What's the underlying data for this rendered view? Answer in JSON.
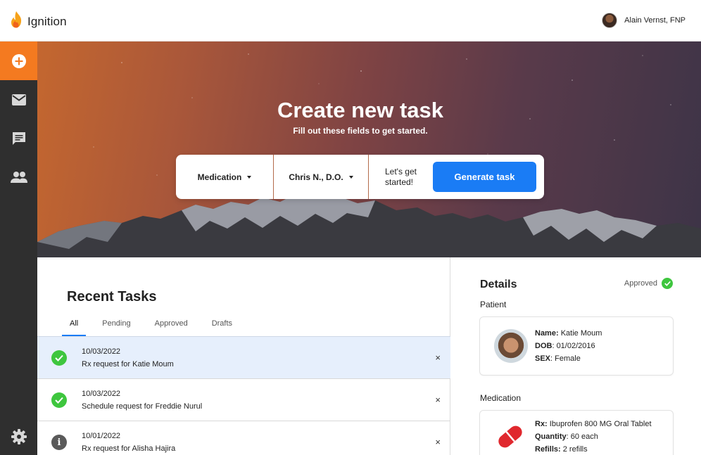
{
  "app": {
    "name": "Ignition",
    "user_name": "Alain Vernst, FNP"
  },
  "sidebar": {
    "items": [
      {
        "name": "add-icon",
        "active": true
      },
      {
        "name": "mail-icon",
        "active": false
      },
      {
        "name": "chat-icon",
        "active": false
      },
      {
        "name": "people-icon",
        "active": false
      }
    ],
    "bottom": {
      "name": "gear-icon"
    }
  },
  "hero": {
    "title": "Create new task",
    "subtitle": "Fill out these fields to get started.",
    "task_type": "Medication",
    "provider": "Chris N., D.O.",
    "hint": "Let's get started!",
    "generate_label": "Generate task"
  },
  "recent": {
    "title": "Recent Tasks",
    "tabs": [
      {
        "label": "All",
        "active": true
      },
      {
        "label": "Pending",
        "active": false
      },
      {
        "label": "Approved",
        "active": false
      },
      {
        "label": "Drafts",
        "active": false
      }
    ],
    "rows": [
      {
        "date": "10/03/2022",
        "desc": "Rx request for Katie Moum",
        "status": "approved",
        "selected": true
      },
      {
        "date": "10/03/2022",
        "desc": "Schedule request for Freddie Nurul",
        "status": "approved",
        "selected": false
      },
      {
        "date": "10/01/2022",
        "desc": "Rx request for Alisha Hajira",
        "status": "info",
        "selected": false
      }
    ],
    "close_symbol": "×"
  },
  "details": {
    "title": "Details",
    "status": "Approved",
    "patient_label": "Patient",
    "patient": {
      "name_key": "Name:",
      "name": "Katie Moum",
      "dob_key": "DOB",
      "dob": ": 01/02/2016",
      "sex_key": "SEX",
      "sex": ": Female"
    },
    "medication_label": "Medication",
    "medication": {
      "rx_key": "Rx:",
      "rx": "Ibuprofen 800 MG Oral Tablet",
      "qty_key": "Quantity",
      "qty": ": 60 each",
      "refills_key": "Refills:",
      "refills": "2 refills"
    }
  },
  "colors": {
    "accent": "#f47a20",
    "primary": "#1a7cf5",
    "success": "#3ec63e",
    "sidebar": "#2f2f2f",
    "pill": "#e0282e"
  }
}
